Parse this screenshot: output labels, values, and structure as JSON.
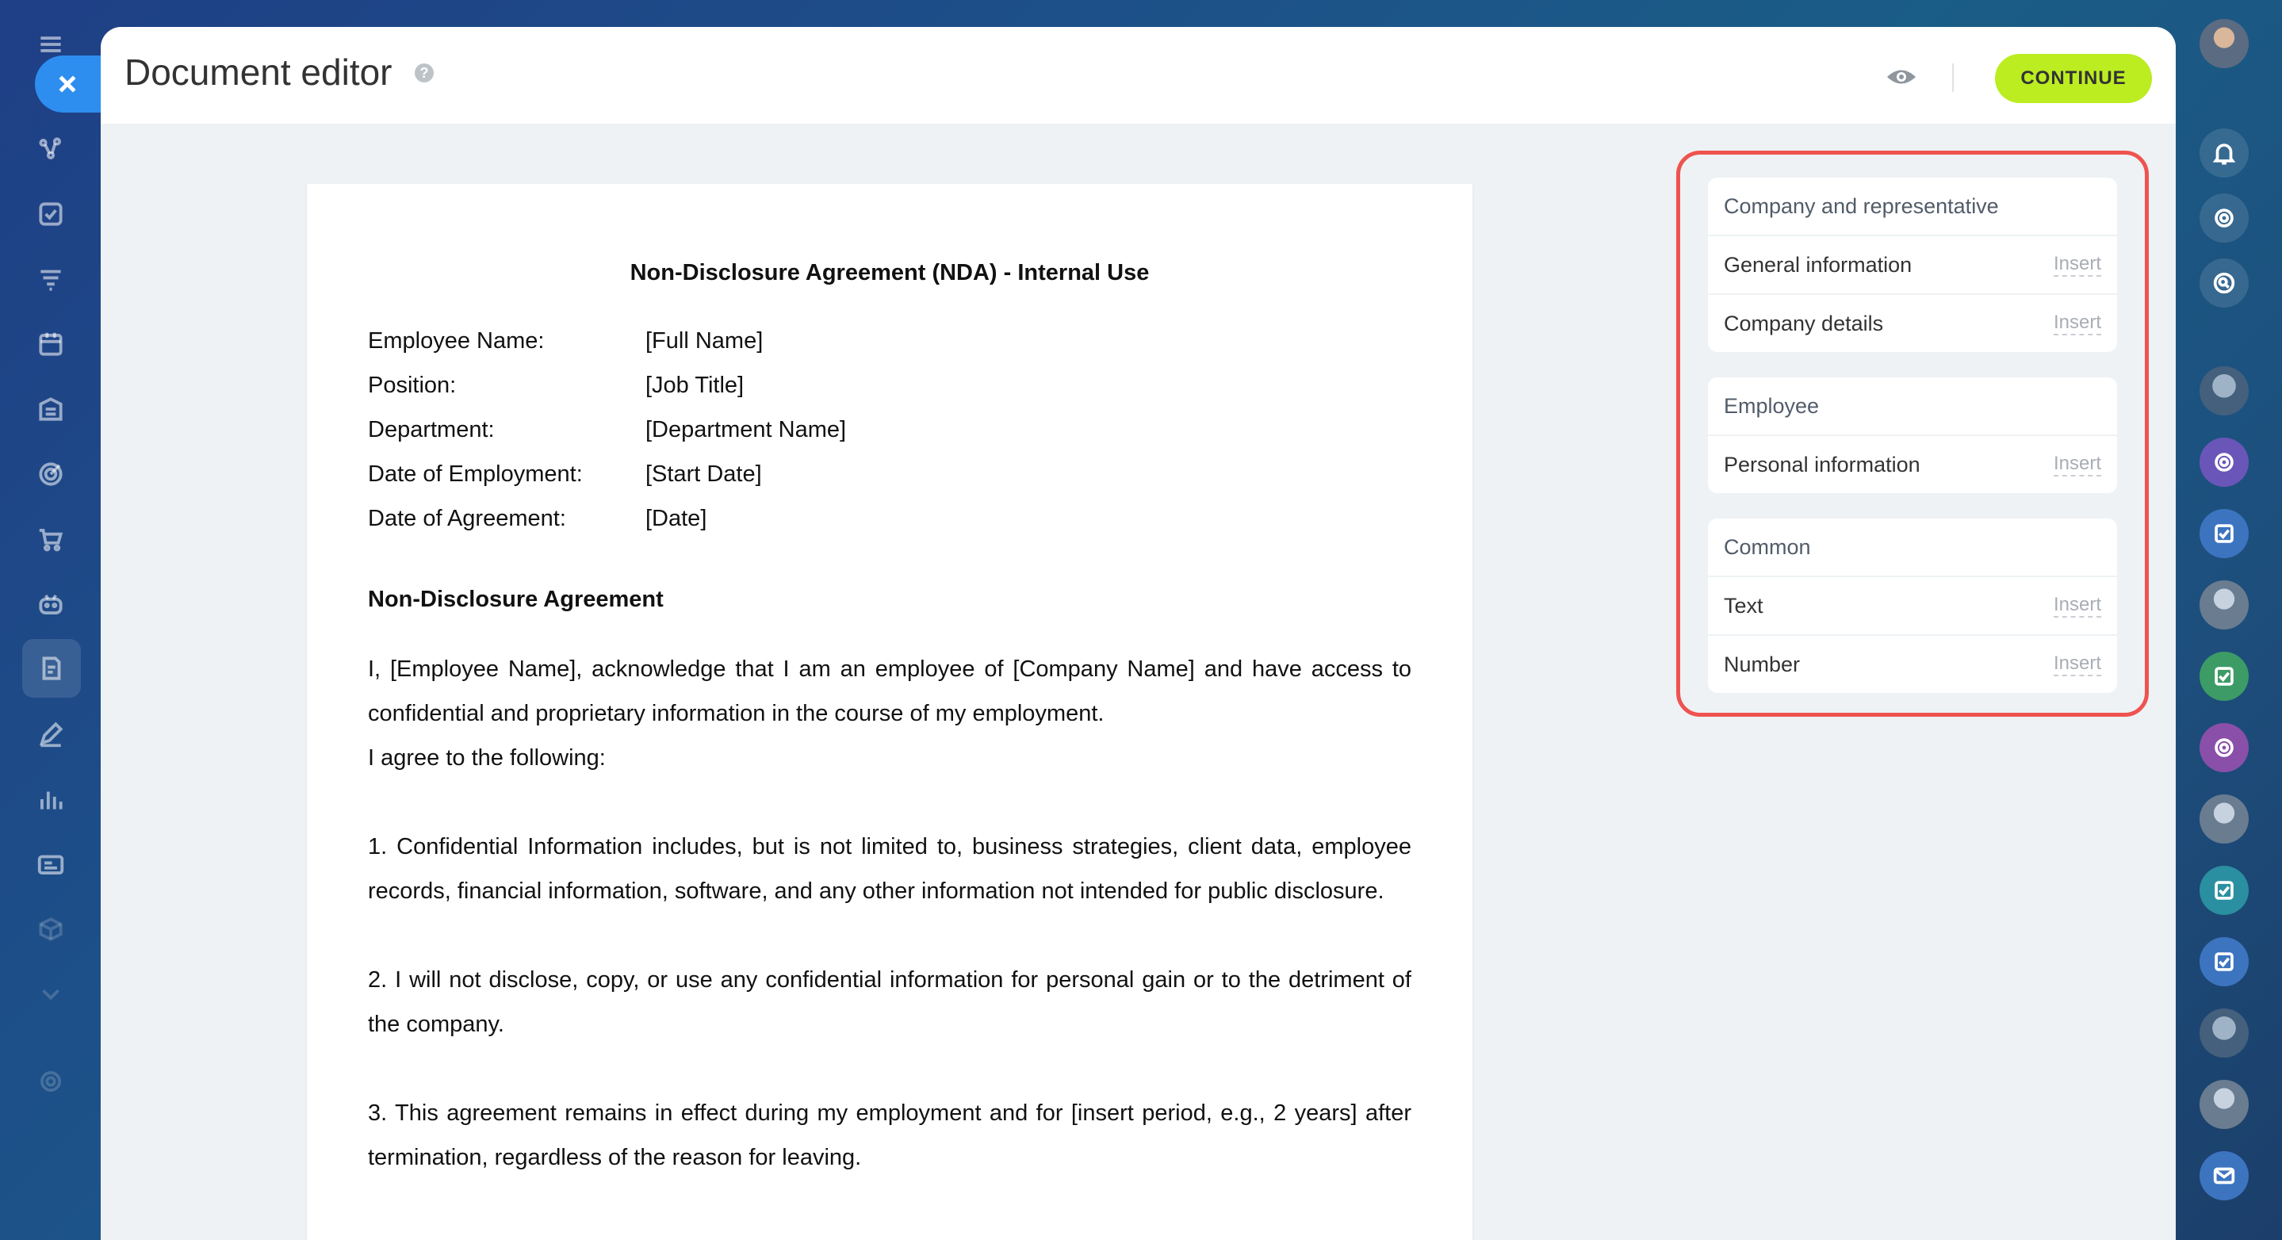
{
  "header": {
    "title": "Document editor",
    "help": "?",
    "continue_label": "CONTINUE"
  },
  "document": {
    "title": "Non-Disclosure Agreement (NDA) - Internal Use",
    "fields": [
      {
        "label": "Employee Name:",
        "value": "[Full Name]"
      },
      {
        "label": "Position:",
        "value": "[Job Title]"
      },
      {
        "label": "Department:",
        "value": "[Department Name]"
      },
      {
        "label": "Date of Employment:",
        "value": "[Start Date]"
      },
      {
        "label": "Date of Agreement:",
        "value": "[Date]"
      }
    ],
    "section_heading": "Non-Disclosure Agreement",
    "paragraphs": [
      "I, [Employee Name], acknowledge that I am an employee of [Company Name] and have access to confidential and proprietary information in the course of my employment.",
      "I agree to the following:",
      "1. Confidential Information includes, but is not limited to, business strategies, client data, employee records, financial information, software, and any other information not intended for public disclosure.",
      "2. I will not disclose, copy, or use any confidential information for personal gain or to the detriment of the company.",
      "3. This agreement remains in effect during my employment and for [insert period, e.g., 2 years] after termination, regardless of the reason for leaving."
    ]
  },
  "fields_panel": {
    "groups": [
      {
        "title": "Company and representative",
        "items": [
          {
            "label": "General information",
            "action": "Insert"
          },
          {
            "label": "Company details",
            "action": "Insert"
          }
        ]
      },
      {
        "title": "Employee",
        "items": [
          {
            "label": "Personal information",
            "action": "Insert"
          }
        ]
      },
      {
        "title": "Common",
        "items": [
          {
            "label": "Text",
            "action": "Insert"
          },
          {
            "label": "Number",
            "action": "Insert"
          }
        ]
      }
    ]
  },
  "colors": {
    "accent_button": "#bbed21",
    "highlight_frame": "#ef5350",
    "close_button": "#2d8ef0"
  }
}
